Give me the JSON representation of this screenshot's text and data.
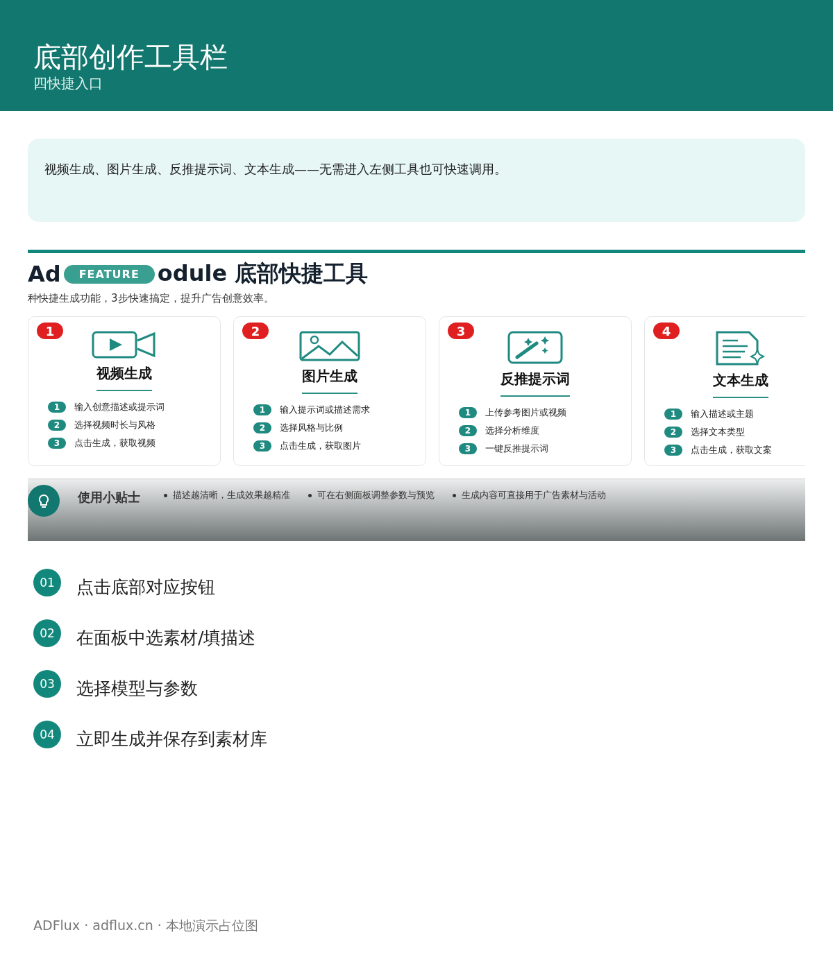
{
  "header": {
    "title": "底部创作工具栏",
    "subtitle": "四快捷入口"
  },
  "intro": "视频生成、图片生成、反推提示词、文本生成——无需进入左侧工具也可快速调用。",
  "feature_image": {
    "title_start": "Ad",
    "badge": "FEATURE",
    "title_end": "odule 底部快捷工具",
    "subtitle": "种快捷生成功能，3步快速搞定，提升广告创意效率。",
    "cards": [
      {
        "number": "1",
        "kind": "video",
        "title": "视频生成",
        "steps": [
          {
            "number": "1",
            "text": "输入创意描述或提示词"
          },
          {
            "number": "2",
            "text": "选择视频时长与风格"
          },
          {
            "number": "3",
            "text": "点击生成，获取视频"
          }
        ]
      },
      {
        "number": "2",
        "kind": "image",
        "title": "图片生成",
        "steps": [
          {
            "number": "1",
            "text": "输入提示词或描述需求"
          },
          {
            "number": "2",
            "text": "选择风格与比例"
          },
          {
            "number": "3",
            "text": "点击生成，获取图片"
          }
        ]
      },
      {
        "number": "3",
        "kind": "wand",
        "title": "反推提示词",
        "steps": [
          {
            "number": "1",
            "text": "上传参考图片或视频"
          },
          {
            "number": "2",
            "text": "选择分析维度"
          },
          {
            "number": "3",
            "text": "一键反推提示词"
          }
        ]
      },
      {
        "number": "4",
        "kind": "document",
        "title": "文本生成",
        "steps": [
          {
            "number": "1",
            "text": "输入描述或主题"
          },
          {
            "number": "2",
            "text": "选择文本类型"
          },
          {
            "number": "3",
            "text": "点击生成，获取文案"
          }
        ]
      }
    ],
    "tips_label": "使用小贴士",
    "tips": [
      "描述越清晰，生成效果越精准",
      "可在右侧面板调整参数与预览",
      "生成内容可直接用于广告素材与活动"
    ]
  },
  "steps": [
    {
      "number": "01",
      "text": "点击底部对应按钮"
    },
    {
      "number": "02",
      "text": "在面板中选素材/填描述"
    },
    {
      "number": "03",
      "text": "选择模型与参数"
    },
    {
      "number": "04",
      "text": "立即生成并保存到素材库"
    }
  ],
  "footer": "ADFlux · adflux.cn · 本地演示占位图"
}
